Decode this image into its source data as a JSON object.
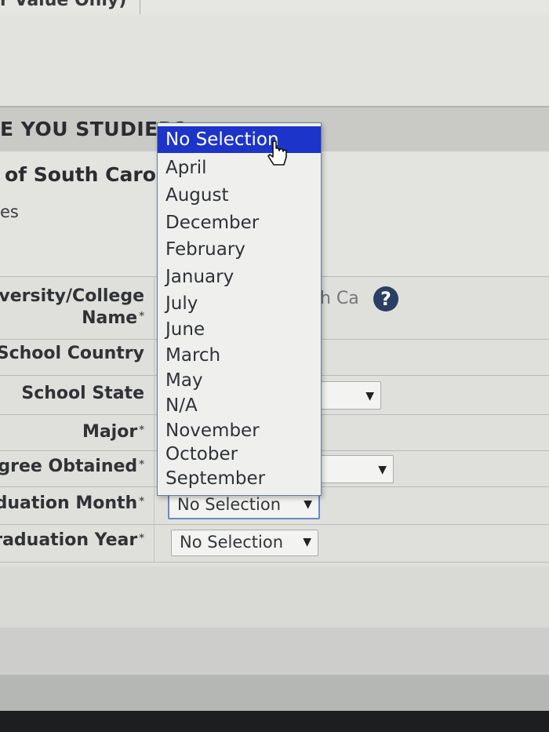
{
  "top": {
    "partial_label": "r Value Only)"
  },
  "section": {
    "title": "E YOU STUDIED?"
  },
  "school": {
    "name": "of South Caro",
    "sub_label": "es"
  },
  "form": {
    "rows": [
      {
        "label_line1": "versity/College",
        "label_line2": "Name",
        "required": "*"
      },
      {
        "label": "School Country"
      },
      {
        "label": "School State"
      },
      {
        "label": "Major",
        "required": "*"
      },
      {
        "label": "egree Obtained",
        "required": "*"
      },
      {
        "label": "aduation Month",
        "required": "*"
      },
      {
        "label": "Graduation Year",
        "required": "*"
      }
    ],
    "university_value_partial": "h Ca",
    "help_icon": "?",
    "grad_month_value": "No Selection",
    "grad_year_value": "No Selection"
  },
  "dropdown": {
    "selected": "No Selection",
    "options": [
      "No Selection",
      "April",
      "August",
      "December",
      "February",
      "January",
      "July",
      "June",
      "March",
      "May",
      "N/A",
      "November",
      "October",
      "September"
    ]
  },
  "icons": {
    "dropdown_arrow": "▼",
    "cursor": "hand-pointer"
  },
  "colors": {
    "highlight": "#1c34c9",
    "help_icon": "#2b3e63",
    "focus_border": "#6f86c7"
  }
}
